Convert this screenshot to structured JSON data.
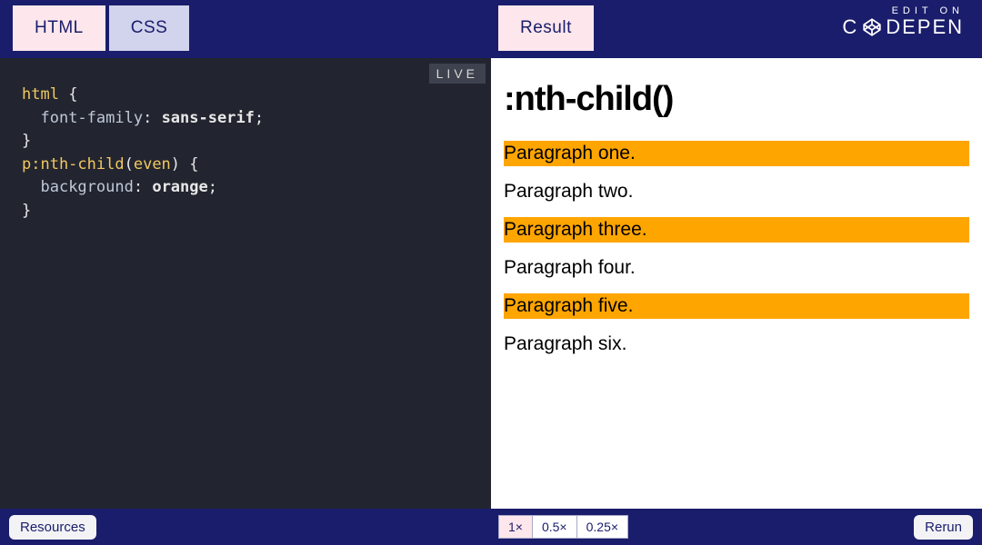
{
  "tabs": {
    "html": "HTML",
    "css": "CSS",
    "result": "Result"
  },
  "branding": {
    "edit_on": "EDIT ON",
    "codepen": "DEPEN",
    "codepen_prefix": "C"
  },
  "live_badge": "LIVE",
  "code": {
    "l1_sel": "html",
    "l1_brace": " {",
    "l2_indent": "  ",
    "l2_prop": "font-family",
    "l2_colon": ": ",
    "l2_val": "sans-serif",
    "l2_semi": ";",
    "l3": "}",
    "l4_sel": "p:nth-child",
    "l4_paren_open": "(",
    "l4_arg": "even",
    "l4_paren_close": ")",
    "l4_brace": " {",
    "l5_indent": "  ",
    "l5_prop": "background",
    "l5_colon": ": ",
    "l5_val": "orange",
    "l5_semi": ";",
    "l6": "}"
  },
  "result": {
    "heading": ":nth-child()",
    "paragraphs": [
      "Paragraph one.",
      "Paragraph two.",
      "Paragraph three.",
      "Paragraph four.",
      "Paragraph five.",
      "Paragraph six."
    ]
  },
  "footer": {
    "resources": "Resources",
    "zoom": [
      "1×",
      "0.5×",
      "0.25×"
    ],
    "rerun": "Rerun"
  }
}
